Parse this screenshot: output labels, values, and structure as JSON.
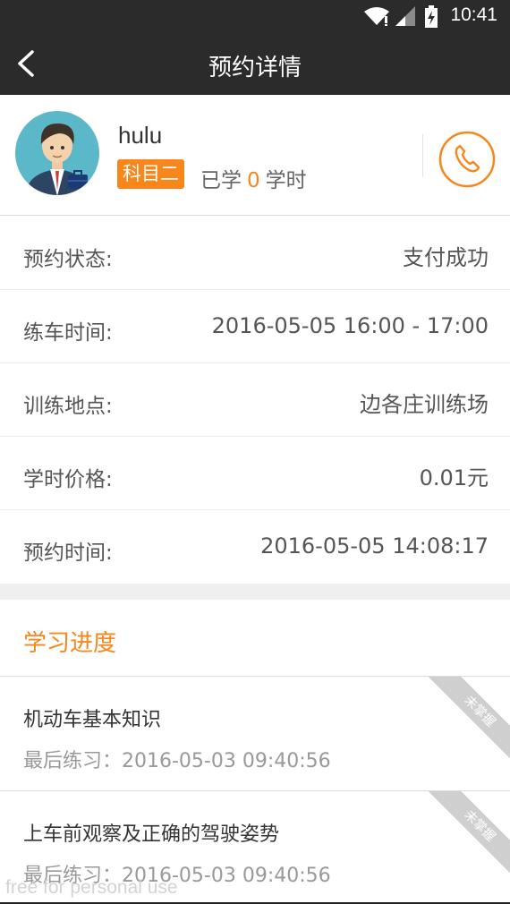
{
  "status_bar": {
    "time": "10:41",
    "icons": [
      "wifi-icon",
      "signal-icon",
      "battery-charging-icon"
    ]
  },
  "header": {
    "title": "预约详情",
    "back_icon": "chevron-left-icon"
  },
  "profile": {
    "username": "hulu",
    "subject": "科目二",
    "studied_prefix": "已学",
    "studied_hours": "0",
    "studied_suffix": "学时",
    "call_icon": "phone-icon"
  },
  "details": [
    {
      "label": "预约状态:",
      "value": "支付成功"
    },
    {
      "label": "练车时间:",
      "value": "2016-05-05 16:00 - 17:00"
    },
    {
      "label": "训练地点:",
      "value": "边各庄训练场"
    },
    {
      "label": "学时价格:",
      "value": "0.01元"
    },
    {
      "label": "预约时间:",
      "value": "2016-05-05 14:08:17"
    }
  ],
  "progress": {
    "title": "学习进度",
    "courses": [
      {
        "name": "机动车基本知识",
        "last_practice": "最后练习：2016-05-03 09:40:56",
        "status": "未掌握"
      },
      {
        "name": "上车前观察及正确的驾驶姿势",
        "last_practice": "最后练习：2016-05-03 09:40:56",
        "status": "未掌握"
      }
    ]
  },
  "watermark": "free for personal use",
  "colors": {
    "accent": "#f7861b",
    "bar": "#2b2b2b",
    "ribbon": "#cfcfcf"
  }
}
